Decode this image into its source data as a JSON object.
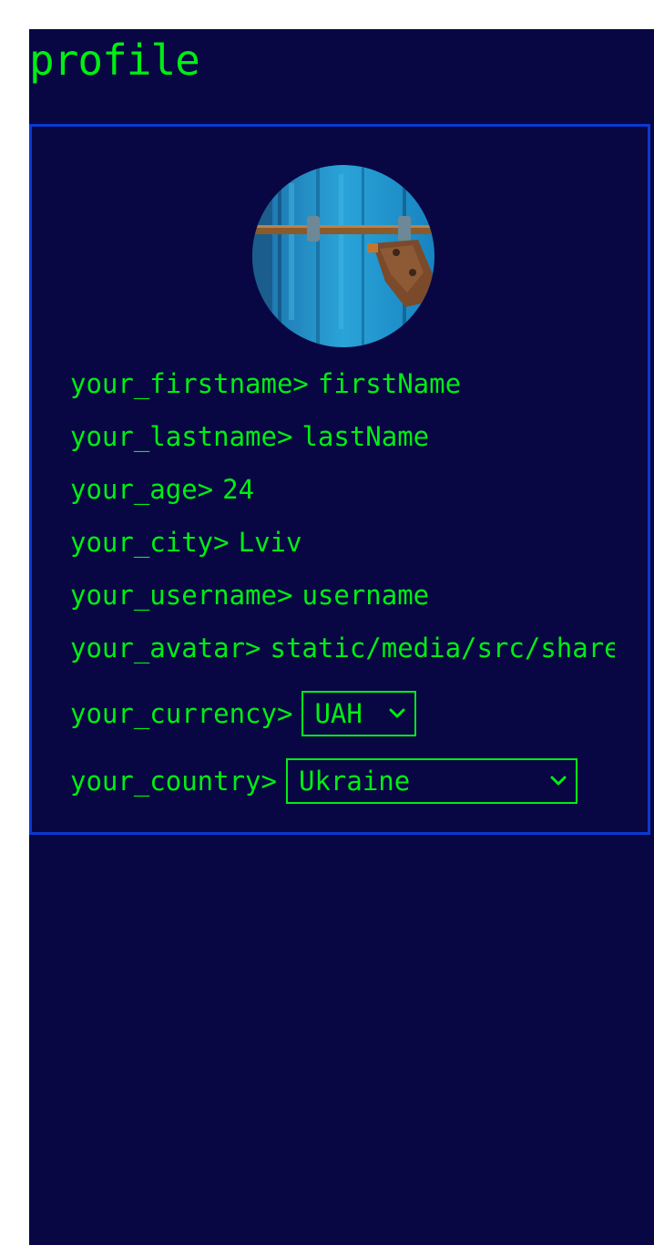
{
  "page": {
    "title": "profile"
  },
  "colors": {
    "background": "#080743",
    "text": "#00ee14",
    "border": "#0a3ad1"
  },
  "profile": {
    "avatar_alt": "padlock on blue door",
    "fields": [
      {
        "label": "your_firstname>",
        "value": "firstName"
      },
      {
        "label": "your_lastname>",
        "value": "lastName"
      },
      {
        "label": "your_age>",
        "value": "24"
      },
      {
        "label": "your_city>",
        "value": "Lviv"
      },
      {
        "label": "your_username>",
        "value": "username"
      },
      {
        "label": "your_avatar>",
        "value": "static/media/src/share"
      }
    ],
    "currency": {
      "label": "your_currency>",
      "selected": "UAH"
    },
    "country": {
      "label": "your_country>",
      "selected": "Ukraine"
    }
  }
}
